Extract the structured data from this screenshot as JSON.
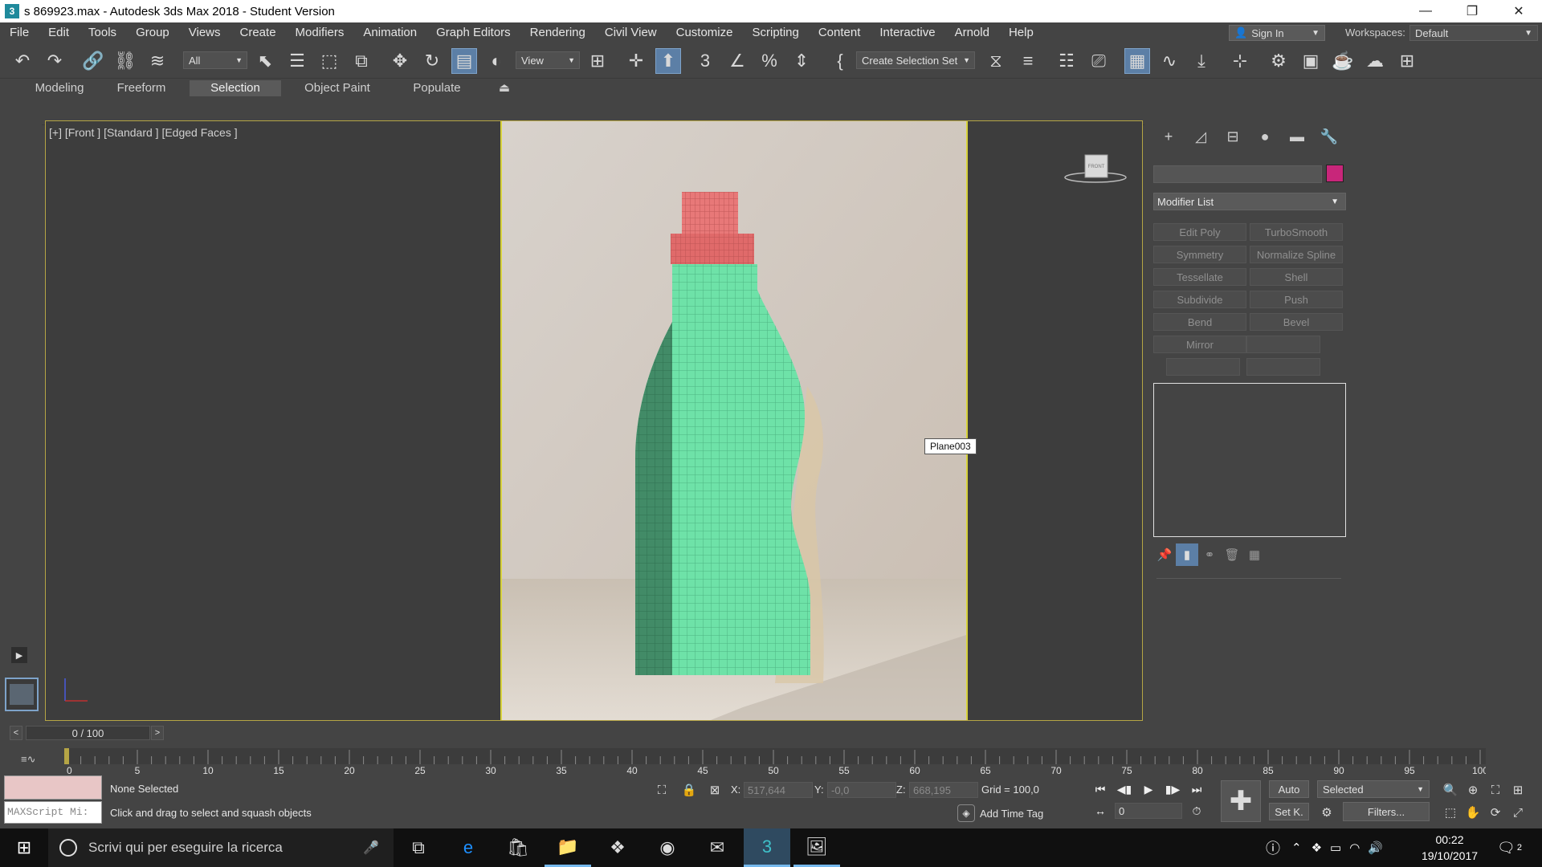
{
  "window": {
    "title": "s 869923.max - Autodesk 3ds Max 2018 - Student Version",
    "app_icon": "3",
    "min_icon": "—",
    "max_icon": "❐",
    "close_icon": "✕"
  },
  "menu": {
    "items": [
      "File",
      "Edit",
      "Tools",
      "Group",
      "Views",
      "Create",
      "Modifiers",
      "Animation",
      "Graph Editors",
      "Rendering",
      "Civil View",
      "Customize",
      "Scripting",
      "Content",
      "Interactive",
      "Arnold",
      "Help"
    ],
    "sign_in": "Sign In",
    "workspaces_label": "Workspaces:",
    "workspace_value": "Default"
  },
  "toolbar": {
    "selection_filter": "All",
    "coord_system": "View",
    "selection_set": "Create Selection Set"
  },
  "ribbon": {
    "tabs": [
      "Modeling",
      "Freeform",
      "Selection",
      "Object Paint",
      "Populate"
    ],
    "active_tab": "Selection"
  },
  "viewport": {
    "label": "[+] [Front ] [Standard ] [Edged Faces ]",
    "tooltip": "Plane003",
    "viewcube_label": "FRONT"
  },
  "command_panel": {
    "modifier_list": "Modifier List",
    "swatch_color": "#c8267a",
    "buttons": [
      [
        "Edit Poly",
        "TurboSmooth"
      ],
      [
        "Symmetry",
        "Normalize Spline"
      ],
      [
        "Tessellate",
        "Shell"
      ],
      [
        "Subdivide",
        "Push"
      ],
      [
        "Bend",
        "Bevel"
      ],
      [
        "Mirror",
        ""
      ],
      [
        "",
        ""
      ]
    ]
  },
  "time_slider": {
    "value": "0 / 100",
    "prev": "<",
    "next": ">"
  },
  "trackbar": {
    "ticks": [
      "0",
      "5",
      "10",
      "15",
      "20",
      "25",
      "30",
      "35",
      "40",
      "45",
      "50",
      "55",
      "60",
      "65",
      "70",
      "75",
      "80",
      "85",
      "90",
      "95",
      "100"
    ]
  },
  "status": {
    "maxscript_placeholder": "MAXScript Mi:",
    "selection_status": "None Selected",
    "prompt": "Click and drag to select and squash objects",
    "x_label": "X:",
    "x_value": "517,644",
    "y_label": "Y:",
    "y_value": "-0,0",
    "z_label": "Z:",
    "z_value": "668,195",
    "grid": "Grid = 100,0",
    "add_time_tag": "Add Time Tag",
    "frame_value": "0",
    "auto_key": "Auto",
    "set_key": "Set K.",
    "key_filter": "Selected",
    "filters": "Filters..."
  },
  "taskbar": {
    "search_placeholder": "Scrivi qui per eseguire la ricerca",
    "time": "00:22",
    "date": "19/10/2017",
    "notifications": "2"
  }
}
